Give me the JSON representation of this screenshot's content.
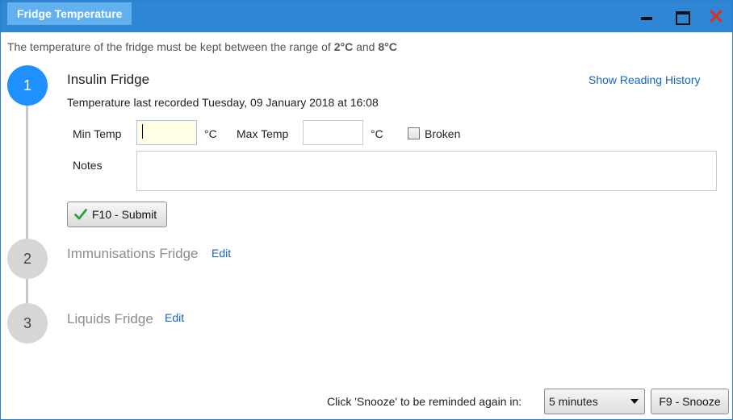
{
  "window": {
    "title": "Fridge Temperature"
  },
  "instruction": {
    "prefix": "The temperature of the fridge must be kept between the range of",
    "min": "2°C",
    "joiner": "and",
    "max": "8°C"
  },
  "steps": [
    {
      "number": "1",
      "name": "Insulin Fridge",
      "state": "active",
      "history_link": "Show Reading History",
      "last_recorded": "Temperature last recorded Tuesday, 09 January 2018 at 16:08",
      "form": {
        "min_label": "Min Temp",
        "min_value": "",
        "min_unit": "°C",
        "max_label": "Max Temp",
        "max_value": "",
        "max_unit": "°C",
        "broken_label": "Broken",
        "broken_checked": false,
        "notes_label": "Notes",
        "notes_value": "",
        "submit_label": "F10 - Submit"
      }
    },
    {
      "number": "2",
      "name": "Immunisations Fridge",
      "state": "inactive",
      "edit_label": "Edit"
    },
    {
      "number": "3",
      "name": "Liquids Fridge",
      "state": "inactive",
      "edit_label": "Edit"
    }
  ],
  "footer": {
    "snooze_text": "Click 'Snooze' to be reminded again in:",
    "snooze_selected": "5 minutes",
    "snooze_button": "F9 - Snooze"
  },
  "colors": {
    "titlebar": "#2f86d4",
    "title_tab": "#62b1ee",
    "step_active": "#1e90ff",
    "step_inactive": "#d6d6d6",
    "link": "#1565c0",
    "check": "#2e9e3e",
    "close": "#d9302a"
  }
}
